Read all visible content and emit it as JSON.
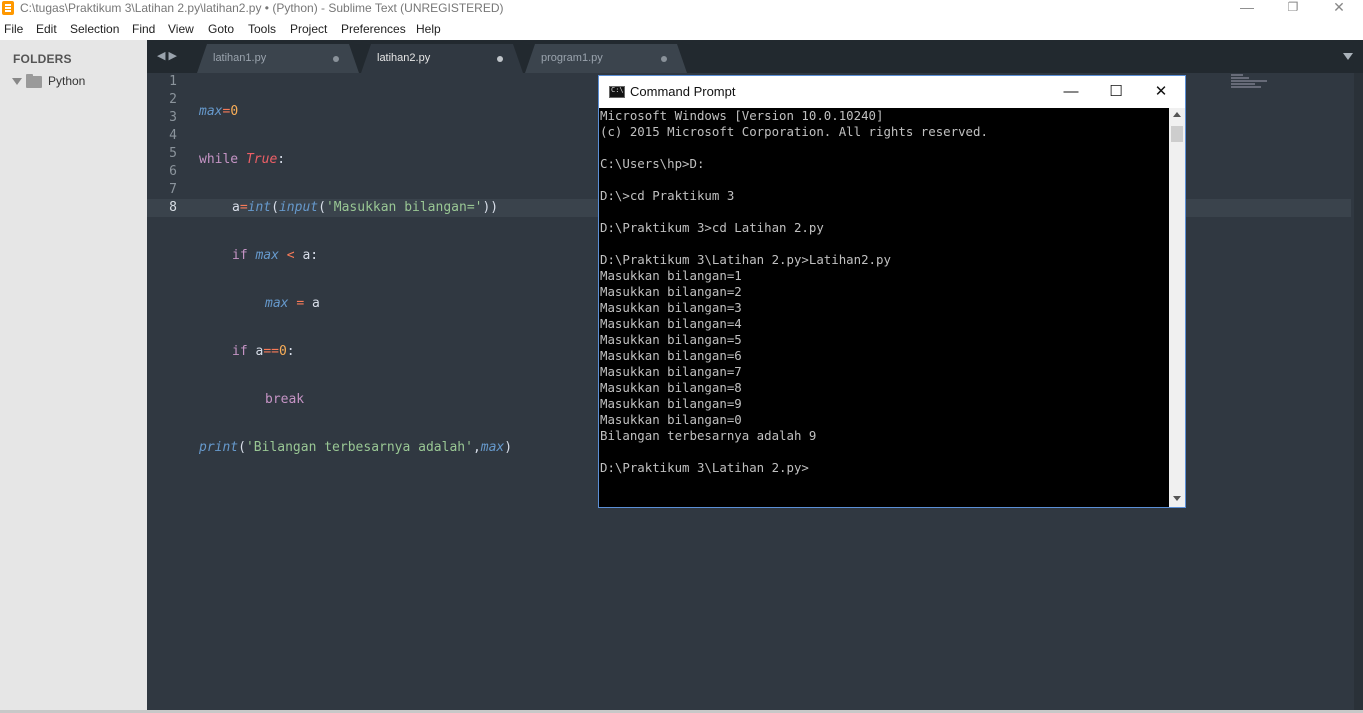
{
  "window": {
    "title": "C:\\tugas\\Praktikum 3\\Latihan 2.py\\latihan2.py • (Python) - Sublime Text (UNREGISTERED)",
    "min_glyph": "—",
    "max_glyph": "❐",
    "close_glyph": "✕"
  },
  "menu": {
    "file": "File",
    "edit": "Edit",
    "selection": "Selection",
    "find": "Find",
    "view": "View",
    "goto": "Goto",
    "tools": "Tools",
    "project": "Project",
    "preferences": "Preferences",
    "help": "Help"
  },
  "sidebar": {
    "title": "FOLDERS",
    "folder": "Python"
  },
  "tabs": {
    "nav_glyphs": "◀▶",
    "items": [
      {
        "label": "latihan1.py",
        "active": false
      },
      {
        "label": "latihan2.py",
        "active": true
      },
      {
        "label": "program1.py",
        "active": false
      }
    ]
  },
  "editor": {
    "line_numbers": [
      "1",
      "2",
      "3",
      "4",
      "5",
      "6",
      "7",
      "8"
    ],
    "current_line": "8",
    "tokens": {
      "max": "max",
      "eq": "=",
      "zero": "0",
      "while": "while",
      "true": "True",
      "colon": ":",
      "a": "a",
      "int": "int",
      "lparen": "(",
      "input": "input",
      "prompt_str": "'Masukkan bilangan='",
      "close2": "))",
      "if": "if",
      "lt": "<",
      "a_colon": "a:",
      "assign": "=",
      "eqeq": "==",
      "break": "break",
      "print": "print",
      "result_str": "'Bilangan terbesarnya adalah'",
      "comma": ",",
      "rparen": ")"
    }
  },
  "cmd": {
    "title": "Command Prompt",
    "min_glyph": "—",
    "max_glyph": "☐",
    "close_glyph": "✕",
    "lines": [
      "Microsoft Windows [Version 10.0.10240]",
      "(c) 2015 Microsoft Corporation. All rights reserved.",
      "",
      "C:\\Users\\hp>D:",
      "",
      "D:\\>cd Praktikum 3",
      "",
      "D:\\Praktikum 3>cd Latihan 2.py",
      "",
      "D:\\Praktikum 3\\Latihan 2.py>Latihan2.py",
      "Masukkan bilangan=1",
      "Masukkan bilangan=2",
      "Masukkan bilangan=3",
      "Masukkan bilangan=4",
      "Masukkan bilangan=5",
      "Masukkan bilangan=6",
      "Masukkan bilangan=7",
      "Masukkan bilangan=8",
      "Masukkan bilangan=9",
      "Masukkan bilangan=0",
      "Bilangan terbesarnya adalah 9",
      "",
      "D:\\Praktikum 3\\Latihan 2.py>"
    ]
  }
}
